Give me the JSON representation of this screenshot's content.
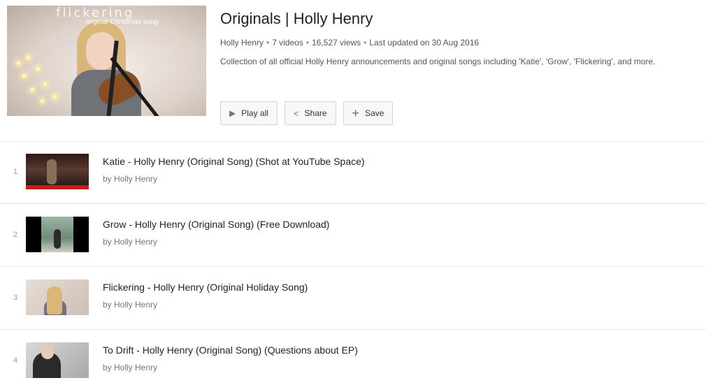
{
  "playlist": {
    "thumbnail_overlay_title": "flickering",
    "thumbnail_overlay_subtitle": "original Christmas song",
    "title": "Originals | Holly Henry",
    "owner": "Holly Henry",
    "video_count": "7 videos",
    "views": "16,527 views",
    "updated": "Last updated on 30 Aug 2016",
    "description": "Collection of all official Holly Henry announcements and original songs including 'Katie', 'Grow', 'Flickering', and more."
  },
  "actions": {
    "play_all": "Play all",
    "share": "Share",
    "save": "Save"
  },
  "videos": [
    {
      "index": "1",
      "title": "Katie - Holly Henry (Original Song) (Shot at YouTube Space)",
      "byline": "by Holly Henry"
    },
    {
      "index": "2",
      "title": "Grow - Holly Henry (Original Song) (Free Download)",
      "byline": "by Holly Henry"
    },
    {
      "index": "3",
      "title": "Flickering - Holly Henry (Original Holiday Song)",
      "byline": "by Holly Henry"
    },
    {
      "index": "4",
      "title": "To Drift - Holly Henry (Original Song) (Questions about EP)",
      "byline": "by Holly Henry"
    }
  ],
  "icons": {
    "play": "play-icon",
    "share": "share-icon",
    "save": "plus-icon"
  }
}
